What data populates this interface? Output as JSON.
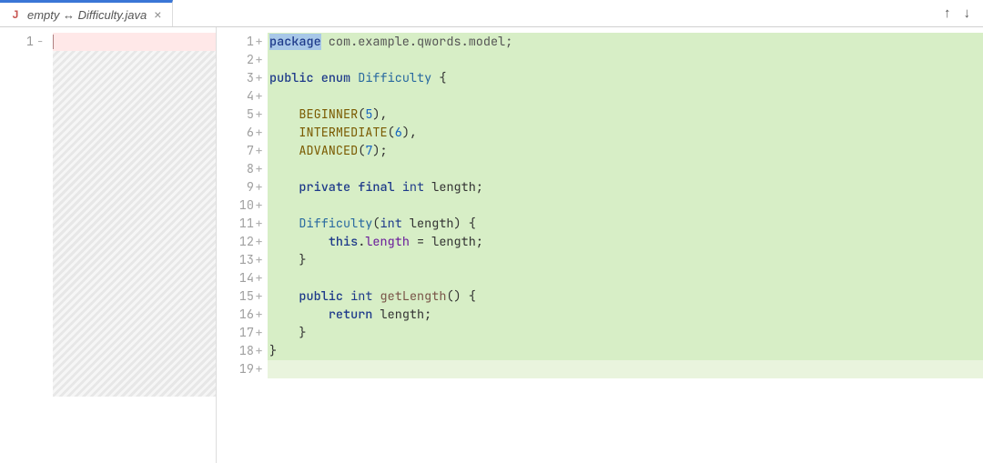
{
  "tab": {
    "icon_letter": "J",
    "label": "empty ↔ Difficulty.java",
    "close_glyph": "×"
  },
  "nav": {
    "up_glyph": "↑",
    "down_glyph": "↓"
  },
  "left": {
    "line_number": "1",
    "marker": "−"
  },
  "right": {
    "lines": [
      {
        "n": 1,
        "m": "+",
        "tokens": [
          {
            "t": "package",
            "c": "kw cursor-sel"
          },
          {
            "t": " com.example.qwords.model;",
            "c": "pkg"
          }
        ]
      },
      {
        "n": 2,
        "m": "+",
        "tokens": []
      },
      {
        "n": 3,
        "m": "+",
        "tokens": [
          {
            "t": "public",
            "c": "kw"
          },
          {
            "t": " ",
            "c": ""
          },
          {
            "t": "enum",
            "c": "kw"
          },
          {
            "t": " ",
            "c": ""
          },
          {
            "t": "Difficulty",
            "c": "cls"
          },
          {
            "t": " {",
            "c": "punc"
          }
        ]
      },
      {
        "n": 4,
        "m": "+",
        "tokens": []
      },
      {
        "n": 5,
        "m": "+",
        "tokens": [
          {
            "t": "    BEGINNER",
            "c": "ident"
          },
          {
            "t": "(",
            "c": "punc"
          },
          {
            "t": "5",
            "c": "num"
          },
          {
            "t": ")",
            "c": "punc"
          },
          {
            "t": ",",
            "c": "punc"
          }
        ]
      },
      {
        "n": 6,
        "m": "+",
        "tokens": [
          {
            "t": "    INTERMEDIATE",
            "c": "ident"
          },
          {
            "t": "(",
            "c": "punc"
          },
          {
            "t": "6",
            "c": "num"
          },
          {
            "t": ")",
            "c": "punc"
          },
          {
            "t": ",",
            "c": "punc"
          }
        ]
      },
      {
        "n": 7,
        "m": "+",
        "tokens": [
          {
            "t": "    ADVANCED",
            "c": "ident"
          },
          {
            "t": "(",
            "c": "punc"
          },
          {
            "t": "7",
            "c": "num"
          },
          {
            "t": ")",
            "c": "punc"
          },
          {
            "t": ";",
            "c": "punc"
          }
        ]
      },
      {
        "n": 8,
        "m": "+",
        "tokens": []
      },
      {
        "n": 9,
        "m": "+",
        "tokens": [
          {
            "t": "    ",
            "c": ""
          },
          {
            "t": "private",
            "c": "kw"
          },
          {
            "t": " ",
            "c": ""
          },
          {
            "t": "final",
            "c": "kw"
          },
          {
            "t": " ",
            "c": ""
          },
          {
            "t": "int",
            "c": "type"
          },
          {
            "t": " length;",
            "c": "punc"
          }
        ]
      },
      {
        "n": 10,
        "m": "+",
        "tokens": []
      },
      {
        "n": 11,
        "m": "+",
        "tokens": [
          {
            "t": "    ",
            "c": ""
          },
          {
            "t": "Difficulty",
            "c": "cls"
          },
          {
            "t": "(",
            "c": "punc"
          },
          {
            "t": "int",
            "c": "type"
          },
          {
            "t": " length",
            "c": "punc"
          },
          {
            "t": ")",
            "c": "punc"
          },
          {
            "t": " {",
            "c": "punc"
          }
        ]
      },
      {
        "n": 12,
        "m": "+",
        "tokens": [
          {
            "t": "        ",
            "c": ""
          },
          {
            "t": "this",
            "c": "kw"
          },
          {
            "t": ".",
            "c": "punc"
          },
          {
            "t": "length",
            "c": "fld"
          },
          {
            "t": " = length;",
            "c": "punc"
          }
        ]
      },
      {
        "n": 13,
        "m": "+",
        "tokens": [
          {
            "t": "    }",
            "c": "punc"
          }
        ]
      },
      {
        "n": 14,
        "m": "+",
        "tokens": []
      },
      {
        "n": 15,
        "m": "+",
        "tokens": [
          {
            "t": "    ",
            "c": ""
          },
          {
            "t": "public",
            "c": "kw"
          },
          {
            "t": " ",
            "c": ""
          },
          {
            "t": "int",
            "c": "type"
          },
          {
            "t": " ",
            "c": ""
          },
          {
            "t": "getLength",
            "c": "mth"
          },
          {
            "t": "()",
            "c": "punc"
          },
          {
            "t": " {",
            "c": "punc"
          }
        ]
      },
      {
        "n": 16,
        "m": "+",
        "tokens": [
          {
            "t": "        ",
            "c": ""
          },
          {
            "t": "return",
            "c": "kw"
          },
          {
            "t": " length;",
            "c": "punc"
          }
        ]
      },
      {
        "n": 17,
        "m": "+",
        "tokens": [
          {
            "t": "    }",
            "c": "punc"
          }
        ]
      },
      {
        "n": 18,
        "m": "+",
        "tokens": [
          {
            "t": "}",
            "c": "punc"
          }
        ]
      },
      {
        "n": 19,
        "m": "+",
        "dim": true,
        "tokens": []
      }
    ]
  }
}
